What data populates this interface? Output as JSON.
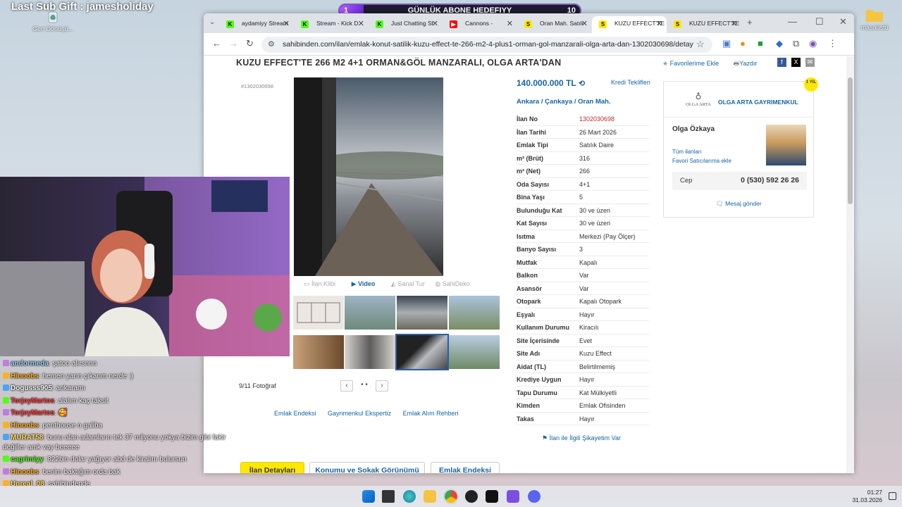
{
  "overlay": {
    "last_sub_gift": "Last Sub Gift : jamesholiday",
    "goal": {
      "label": "GÜNLÜK ABONE HEDEFIYY",
      "current": "1",
      "target": "10",
      "progress": 0.1
    }
  },
  "desktop": {
    "recycle_label": "Geri Dönüşü...",
    "folder_label": "masaüstü"
  },
  "browser": {
    "tabs": [
      {
        "title": "aydamiyy Stream",
        "icon": "kick-icon",
        "color": "#53fc18"
      },
      {
        "title": "Stream - Kick D",
        "icon": "kick-icon",
        "color": "#53fc18"
      },
      {
        "title": "Just Chatting St",
        "icon": "kick-icon",
        "color": "#53fc18"
      },
      {
        "title": "Cannons -",
        "icon": "youtube-icon",
        "color": "#ff0000"
      },
      {
        "title": "Oran Mah. Satılı",
        "icon": "sahibinden-icon",
        "color": "#ffe800"
      },
      {
        "title": "KUZU EFFECT'TE",
        "icon": "sahibinden-icon",
        "color": "#ffe800"
      },
      {
        "title": "KUZU EFFECT'TE",
        "icon": "sahibinden-icon",
        "color": "#ffe800"
      }
    ],
    "url": "sahibinden.com/ilan/emlak-konut-satilik-kuzu-effect-te-266-m2-4-plus1-orman-gol-manzarali-olga-arta-dan-1302030698/detay"
  },
  "listing": {
    "title": "KUZU EFFECT'TE 266 M2 4+1 ORMAN&GÖL MANZARALI, OLGA ARTA'DAN",
    "favorite_label": "Favorilerime Ekle",
    "print_label": "Yazdır",
    "listing_id_small": "#1302030698",
    "price": "140.000.000 TL",
    "kredi_label": "Kredi Teklifleri",
    "location": [
      "Ankara",
      "Çankaya",
      "Oran Mah."
    ],
    "media_tabs": [
      "İlan Klibi",
      "Video",
      "Sanal Tur",
      "SahiDeko"
    ],
    "photo_count": "9/11 Fotoğraf",
    "details": [
      {
        "key": "İlan No",
        "value": "1302030698",
        "highlight": true
      },
      {
        "key": "İlan Tarihi",
        "value": "26 Mart 2026"
      },
      {
        "key": "Emlak Tipi",
        "value": "Satılık Daire"
      },
      {
        "key": "m² (Brüt)",
        "value": "316"
      },
      {
        "key": "m² (Net)",
        "value": "266"
      },
      {
        "key": "Oda Sayısı",
        "value": "4+1"
      },
      {
        "key": "Bina Yaşı",
        "value": "5"
      },
      {
        "key": "Bulunduğu Kat",
        "value": "30 ve üzeri"
      },
      {
        "key": "Kat Sayısı",
        "value": "30 ve üzeri"
      },
      {
        "key": "Isıtma",
        "value": "Merkezi (Pay Ölçer)"
      },
      {
        "key": "Banyo Sayısı",
        "value": "3"
      },
      {
        "key": "Mutfak",
        "value": "Kapalı"
      },
      {
        "key": "Balkon",
        "value": "Var"
      },
      {
        "key": "Asansör",
        "value": "Var"
      },
      {
        "key": "Otopark",
        "value": "Kapalı Otopark"
      },
      {
        "key": "Eşyalı",
        "value": "Hayır"
      },
      {
        "key": "Kullanım Durumu",
        "value": "Kiracılı"
      },
      {
        "key": "Site İçerisinde",
        "value": "Evet"
      },
      {
        "key": "Site Adı",
        "value": "Kuzu Effect"
      },
      {
        "key": "Aidat (TL)",
        "value": "Belirtilmemiş"
      },
      {
        "key": "Krediye Uygun",
        "value": "Hayır"
      },
      {
        "key": "Tapu Durumu",
        "value": "Kat Mülkiyetli"
      },
      {
        "key": "Kimden",
        "value": "Emlak Ofisinden"
      },
      {
        "key": "Takas",
        "value": "Hayır"
      }
    ],
    "complaint": "İlan ile İlgili Şikayetim Var",
    "bottom_links": [
      "Emlak Endeksi",
      "Gayrimenkul Ekspertiz",
      "Emlak Alım Rehberi"
    ],
    "bottom_tabs": [
      "İlan Detayları",
      "Konumu ve Sokak Görünümü",
      "Emlak Endeksi"
    ]
  },
  "seller": {
    "company": "OLGA ARTA GAYRIMENKUL",
    "logo_text": "OLGA ARTA",
    "years_badge": "1 YIL",
    "agent": "Olga Özkaya",
    "all_listings": "Tüm ilanları",
    "add_favorite": "Favori Satıcılarıma ekle",
    "phone_label": "Cep",
    "phone": "0 (530) 592 26 26",
    "message": "Mesaj gönder"
  },
  "chat": [
    {
      "user": "andormeda",
      "color": "#9ad0ff",
      "text": "şatoo alırsnnn"
    },
    {
      "user": "Hinoobs",
      "color": "#ffb020",
      "text": "hemen yarın çıkarım nerde :)"
    },
    {
      "user": "Dogusss905",
      "color": "#ffffff",
      "text": "ankaramı"
    },
    {
      "user": "TorjeyMartos",
      "color": "#ff3b3b",
      "text": "alalım kaç taksit"
    },
    {
      "user": "TorjeyMartos",
      "color": "#ff3b3b",
      "text": "🥰"
    },
    {
      "user": "Hinoobs",
      "color": "#ffb020",
      "text": "penthouse o galiba"
    },
    {
      "user": "MURAT58",
      "color": "#ffe066",
      "text": "bunu alan adamların tek 37 milyonu yokya bizim gibi fakir değiller amk vay beeeee"
    },
    {
      "user": "cagrimiyy",
      "color": "#53fc18",
      "text": "822bin dolar yağıyor abd de kiralını bulursun"
    },
    {
      "user": "Hinoobs",
      "color": "#ffb020",
      "text": "benim baktığım orda bak"
    },
    {
      "user": "Unreal_08",
      "color": "#ffe066",
      "text": "sahibindende"
    }
  ],
  "taskbar": {
    "time": "01:27",
    "date": "31.03.2026"
  }
}
